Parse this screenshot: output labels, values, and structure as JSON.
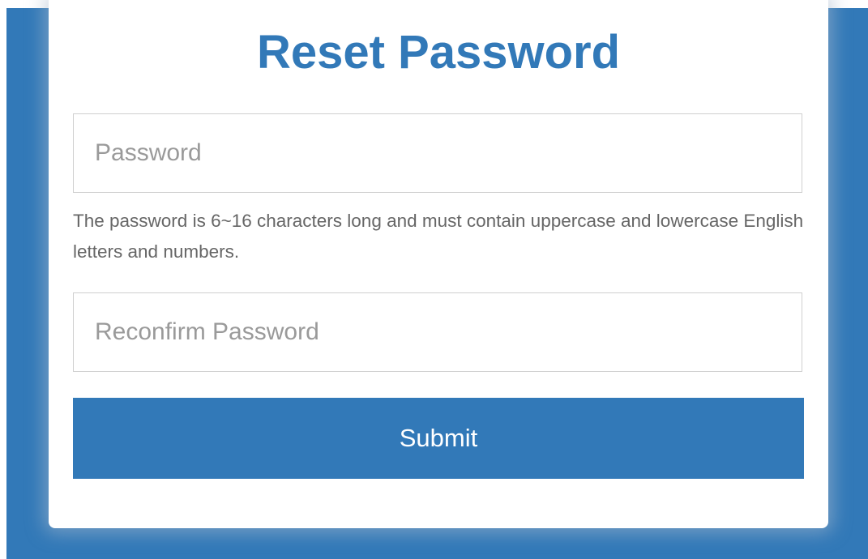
{
  "theme": {
    "accent": "#3279b8",
    "background": "#3279b8",
    "card": "#ffffff",
    "hint_text": "#666666",
    "placeholder_text": "#9a9a9a"
  },
  "form": {
    "title": "Reset Password",
    "password": {
      "placeholder": "Password",
      "value": ""
    },
    "hint": "The password is 6~16 characters long and must contain uppercase and lowercase English letters and numbers.",
    "confirm_password": {
      "placeholder": "Reconfirm Password",
      "value": ""
    },
    "submit_label": "Submit"
  }
}
